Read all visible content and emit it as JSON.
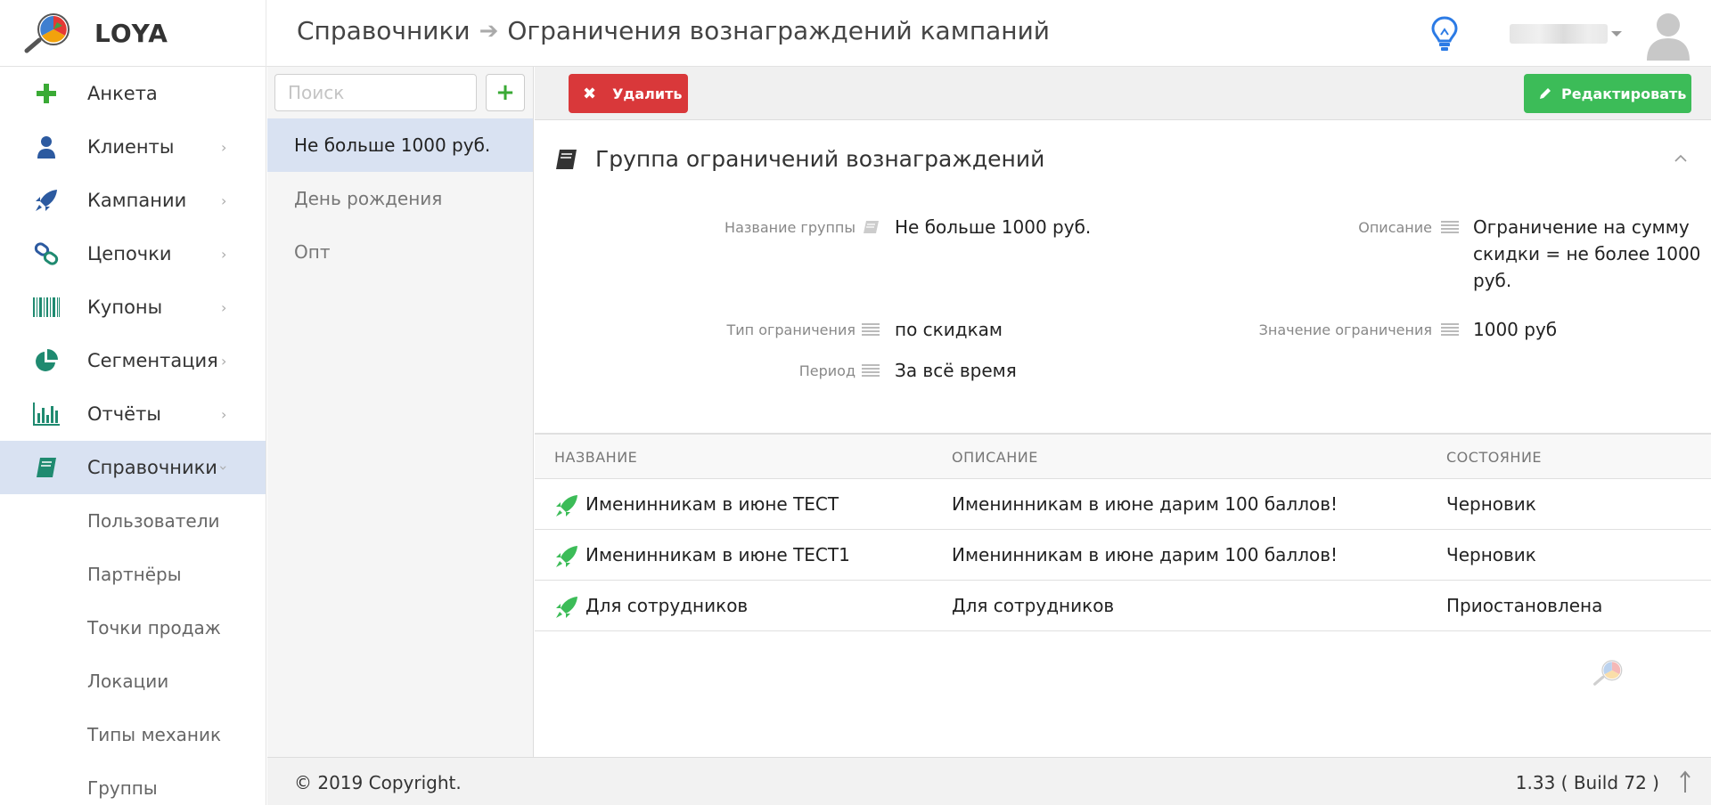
{
  "app": {
    "brand": "LOYA"
  },
  "header": {
    "breadcrumb_parent": "Справочники",
    "breadcrumb_current": "Ограничения вознаграждений кампаний"
  },
  "sidebar": {
    "items": [
      {
        "label": "Анкета",
        "icon": "plus-icon"
      },
      {
        "label": "Клиенты",
        "icon": "user-icon"
      },
      {
        "label": "Кампании",
        "icon": "rocket-icon"
      },
      {
        "label": "Цепочки",
        "icon": "link-icon"
      },
      {
        "label": "Купоны",
        "icon": "barcode-icon"
      },
      {
        "label": "Сегментация",
        "icon": "pie-chart-icon"
      },
      {
        "label": "Отчёты",
        "icon": "bar-chart-icon"
      },
      {
        "label": "Справочники",
        "icon": "book-icon"
      }
    ],
    "subitems": [
      "Пользователи",
      "Партнёры",
      "Точки продаж",
      "Локации",
      "Типы механик",
      "Группы"
    ]
  },
  "list": {
    "search_placeholder": "Поиск",
    "add_label": "+",
    "items": [
      "Не больше 1000 руб.",
      "День рождения",
      "Опт"
    ]
  },
  "toolbar": {
    "delete_label": "Удалить",
    "edit_label": "Редактировать"
  },
  "group": {
    "title": "Группа ограничений вознаграждений",
    "name_label": "Название группы",
    "name_value": "Не больше 1000 руб.",
    "desc_label": "Описание",
    "desc_line1": "Ограничение на сумму",
    "desc_line2": "скидки = не более 1000",
    "desc_line3": "руб.",
    "type_label": "Тип ограничения",
    "type_value": "по скидкам",
    "limit_label": "Значение ограничения",
    "limit_value": "1000 руб",
    "period_label": "Период",
    "period_value": "За всё время"
  },
  "table": {
    "columns": [
      "НАЗВАНИЕ",
      "ОПИСАНИЕ",
      "СОСТОЯНИЕ"
    ],
    "rows": [
      {
        "name": "Именинникам в июне ТЕСТ",
        "description": "Именинникам в июне дарим 100 баллов!",
        "status": "Черновик"
      },
      {
        "name": "Именинникам в июне ТЕСТ1",
        "description": "Именинникам в июне дарим 100 баллов!",
        "status": "Черновик"
      },
      {
        "name": "Для сотрудников",
        "description": "Для сотрудников",
        "status": "Приостановлена"
      }
    ]
  },
  "footer": {
    "copyright": "© 2019 Copyright.",
    "version": "1.33 ( Build 72 )"
  },
  "colors": {
    "accent_green": "#3cbc58",
    "danger_red": "#d9383a",
    "active_bg": "#d9e2f2",
    "teal_icon": "#1f8a70",
    "blue_icon": "#2c5aa0"
  }
}
